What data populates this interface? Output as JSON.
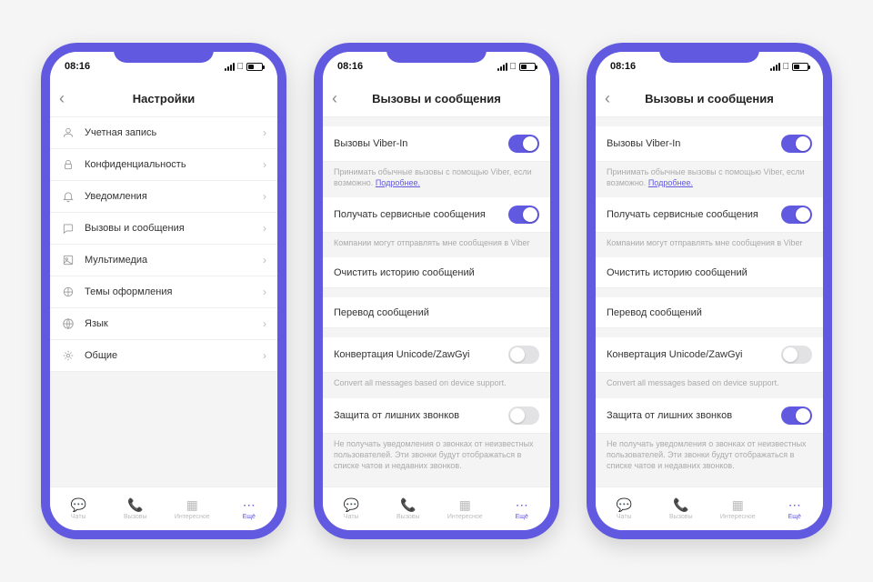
{
  "status": {
    "time": "08:16"
  },
  "phone1": {
    "title": "Настройки",
    "items": [
      {
        "label": "Учетная запись"
      },
      {
        "label": "Конфиденциальность"
      },
      {
        "label": "Уведомления"
      },
      {
        "label": "Вызовы и сообщения"
      },
      {
        "label": "Мультимедиа"
      },
      {
        "label": "Темы оформления"
      },
      {
        "label": "Язык"
      },
      {
        "label": "Общие"
      }
    ]
  },
  "calls": {
    "title": "Вызовы и сообщения",
    "viber_in": {
      "label": "Вызовы Viber-In",
      "desc": "Принимать обычные вызовы с помощью Viber, если возможно.",
      "more": "Подробнее."
    },
    "service": {
      "label": "Получать сервисные сообщения",
      "desc": "Компании могут отправлять мне сообщения в Viber"
    },
    "clear": "Очистить историю сообщений",
    "translate": "Перевод сообщений",
    "unicode": {
      "label": "Конвертация Unicode/ZawGyi",
      "desc": "Convert all messages based on device support."
    },
    "spam": {
      "label": "Защита от лишних звонков",
      "desc": "Не получать уведомления о звонках от неизвестных пользователей. Эти звонки будут отображаться в списке чатов и недавних звонков."
    }
  },
  "tabs": {
    "chats": "Чаты",
    "calls": "Вызовы",
    "explore": "Интересное",
    "more": "Ещё"
  },
  "toggles": {
    "p2": {
      "viber_in": true,
      "service": true,
      "unicode": false,
      "spam": false
    },
    "p3": {
      "viber_in": true,
      "service": true,
      "unicode": false,
      "spam": true
    }
  }
}
